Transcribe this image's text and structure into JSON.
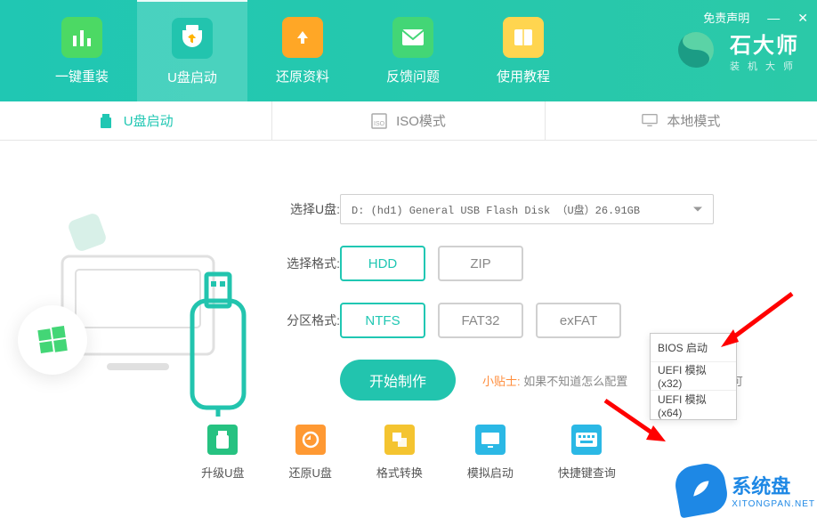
{
  "header": {
    "disclaimer": "免责声明",
    "nav": [
      {
        "label": "一键重装",
        "icon_color": "#6ed86b"
      },
      {
        "label": "U盘启动",
        "icon_color": "#22c4ae"
      },
      {
        "label": "还原资料",
        "icon_color": "#ffa726"
      },
      {
        "label": "反馈问题",
        "icon_color": "#43d676"
      },
      {
        "label": "使用教程",
        "icon_color": "#ffd54f"
      }
    ],
    "brand_title": "石大师",
    "brand_sub": "装机大师"
  },
  "subtabs": [
    {
      "label": "U盘启动",
      "active": true
    },
    {
      "label": "ISO模式",
      "active": false
    },
    {
      "label": "本地模式",
      "active": false
    }
  ],
  "form": {
    "select_label": "选择U盘:",
    "select_value": "D: (hd1) General USB Flash Disk （U盘）26.91GB",
    "format_label": "选择格式:",
    "format_options": [
      {
        "label": "HDD",
        "selected": true
      },
      {
        "label": "ZIP",
        "selected": false
      }
    ],
    "partition_label": "分区格式:",
    "partition_options": [
      {
        "label": "NTFS",
        "selected": true
      },
      {
        "label": "FAT32",
        "selected": false
      },
      {
        "label": "exFAT",
        "selected": false
      }
    ],
    "start_label": "开始制作",
    "tip_label": "小贴士:",
    "tip_text": "如果不知道怎么配置",
    "tip_suffix": "即可"
  },
  "popup": {
    "items": [
      "BIOS 启动",
      "UEFI 模拟(x32)",
      "UEFI 模拟(x64)"
    ]
  },
  "tools": [
    {
      "label": "升级U盘",
      "color": "#26c281"
    },
    {
      "label": "还原U盘",
      "color": "#ff9933"
    },
    {
      "label": "格式转换",
      "color": "#f4c430"
    },
    {
      "label": "模拟启动",
      "color": "#2bb8e5"
    },
    {
      "label": "快捷键查询",
      "color": "#2bb8e5"
    }
  ],
  "watermark": {
    "cn": "系统盘",
    "en": "XITONGPAN.NET"
  }
}
